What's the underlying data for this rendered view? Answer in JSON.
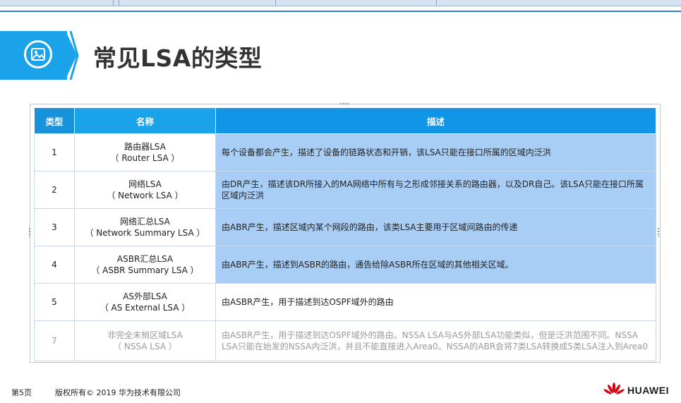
{
  "header": {
    "title": "常见LSA的类型"
  },
  "table": {
    "columns": [
      "类型",
      "名称",
      "描述"
    ],
    "rows": [
      {
        "type": "1",
        "name_cn": "路由器LSA",
        "name_en": "（ Router LSA ）",
        "desc": "每个设备都会产生，描述了设备的链路状态和开销，该LSA只能在接口所属的区域内泛洪"
      },
      {
        "type": "2",
        "name_cn": "网络LSA",
        "name_en": "（ Network LSA ）",
        "desc": "由DR产生，描述该DR所接入的MA网络中所有与之形成邻接关系的路由器，以及DR自己。该LSA只能在接口所属区域内泛洪"
      },
      {
        "type": "3",
        "name_cn": "网络汇总LSA",
        "name_en": "（ Network Summary LSA ）",
        "desc": "由ABR产生，描述区域内某个网段的路由，该类LSA主要用于区域间路由的传递"
      },
      {
        "type": "4",
        "name_cn": "ASBR汇总LSA",
        "name_en": "（ ASBR Summary LSA ）",
        "desc": "由ABR产生，描述到ASBR的路由，通告给除ASBR所在区域的其他相关区域。"
      },
      {
        "type": "5",
        "name_cn": "AS外部LSA",
        "name_en": "（ AS External LSA ）",
        "desc": "由ASBR产生，用于描述到达OSPF域外的路由"
      },
      {
        "type": "7",
        "name_cn": "非完全末梢区域LSA",
        "name_en": "（ NSSA LSA ）",
        "desc": "由ASBR产生，用于描述到达OSPF域外的路由。NSSA LSA与AS外部LSA功能类似，但是泛洪范围不同。NSSA LSA只能在始发的NSSA内泛洪，并且不能直接进入Area0。NSSA的ABR会将7类LSA转换成5类LSA注入到Area0"
      }
    ]
  },
  "footer": {
    "page": "第5页",
    "copyright": "版权所有© 2019 华为技术有限公司",
    "brand": "HUAWEI"
  },
  "icons": {
    "header_badge": "image-icon",
    "brand_logo": "huawei-petal-icon"
  },
  "colors": {
    "accent": "#1aa3e8",
    "header_bg": "#1195e6",
    "highlight_row": "#a9cef6"
  }
}
